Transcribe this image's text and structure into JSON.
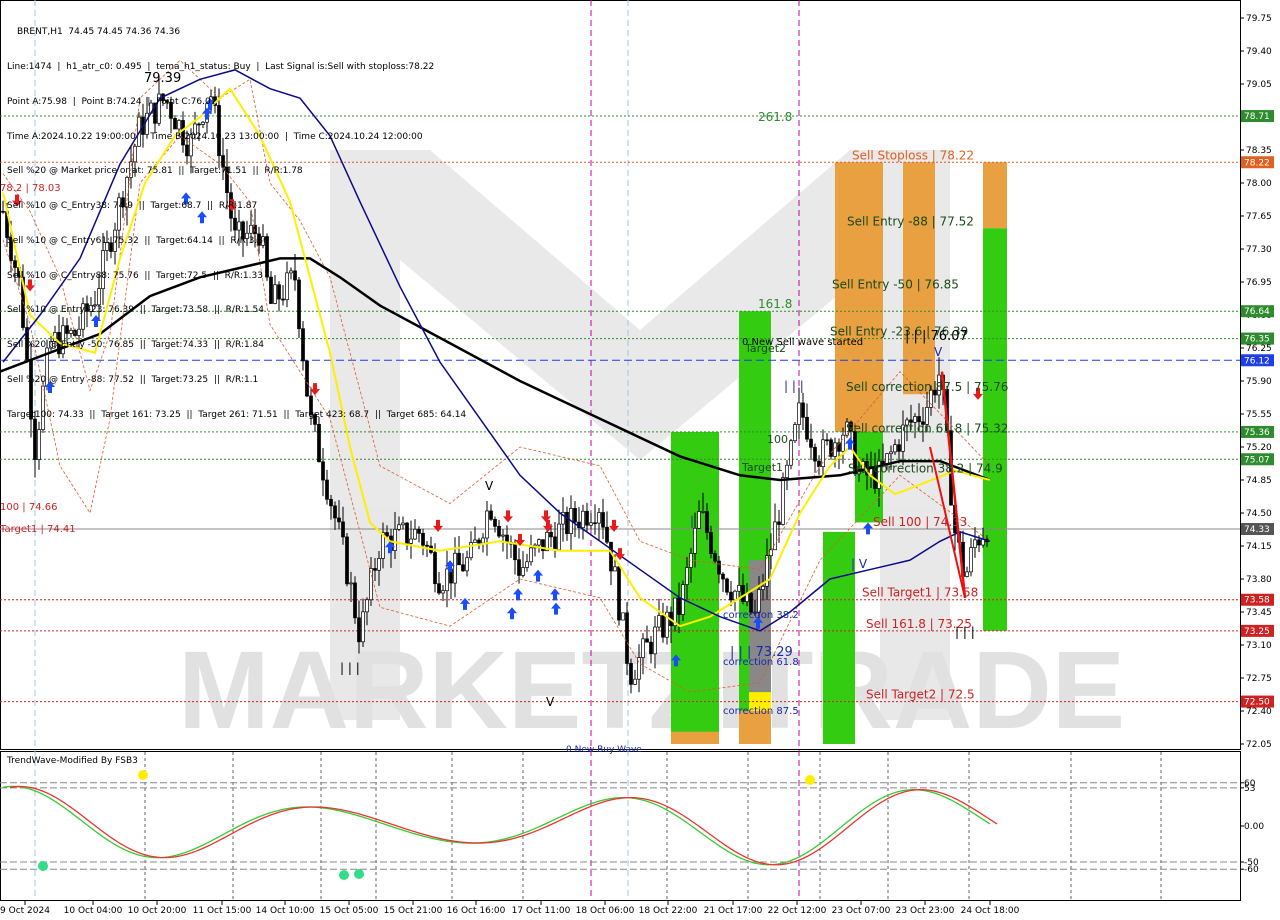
{
  "instrument": {
    "symbol_header": "BRENT,H1  74.45 74.45 74.36 74.36"
  },
  "info_lines": [
    "Line:1474  |  h1_atr_c0: 0.495  |  tema_h1_status: Buy  |  Last Signal is:Sell with stoploss:78.22",
    "Point A:75.98  |  Point B:74.24  |  Point C:76.07",
    "Time A:2024.10.22 19:00:00  |  Time B:2024.10.23 13:00:00  |  Time C:2024.10.24 12:00:00",
    "Sell %20 @ Market price or at: 75.81  ||  Target:71.51  ||  R/R:1.78",
    "Sell %10 @ C_Entry38: 74.9  ||  Target:68.7  ||  R/R:1.87",
    "Sell %10 @ C_Entry61: 75.32  ||  Target:64.14  ||  R/R:3.86",
    "Sell %10 @ C_Entry88: 75.76  ||  Target:72.5  ||  R/R:1.33",
    "Sell %10 @ Entry -23: 76.39  ||  Target:73.58  ||  R/R:1.54",
    "Sell %20 @ Entry -50: 76.85  ||  Target:74.33  ||  R/R:1.84",
    "Sell %20 @ Entry -88: 77.52  ||  Target:73.25  ||  R/R:1.1",
    "Target100: 74.33  ||  Target 161: 73.25  ||  Target 261: 71.51  ||  Target 423: 68.7  ||  Target 685: 64.14"
  ],
  "watermark": "MARKETZITRADE",
  "price_axis": {
    "ticks": [
      "79.75",
      "79.40",
      "79.05",
      "78.70",
      "78.35",
      "78.00",
      "77.65",
      "77.30",
      "76.95",
      "76.60",
      "76.25",
      "75.90",
      "75.55",
      "75.20",
      "74.85",
      "74.50",
      "74.15",
      "73.80",
      "73.45",
      "73.10",
      "72.75",
      "72.40",
      "72.05"
    ],
    "tags": [
      {
        "label": "78.71",
        "value": 78.71,
        "color": "#2e8b2e"
      },
      {
        "label": "78.22",
        "value": 78.22,
        "color": "#e06020"
      },
      {
        "label": "76.64",
        "value": 76.64,
        "color": "#2e8b2e"
      },
      {
        "label": "76.35",
        "value": 76.35,
        "color": "#2e8b2e"
      },
      {
        "label": "76.12",
        "value": 76.12,
        "color": "#1e3ee8"
      },
      {
        "label": "75.36",
        "value": 75.36,
        "color": "#2e8b2e"
      },
      {
        "label": "75.07",
        "value": 75.07,
        "color": "#2e8b2e"
      },
      {
        "label": "74.33",
        "value": 74.33,
        "color": "#555555"
      },
      {
        "label": "73.58",
        "value": 73.58,
        "color": "#cc2222"
      },
      {
        "label": "73.25",
        "value": 73.25,
        "color": "#cc2222"
      },
      {
        "label": "72.50",
        "value": 72.5,
        "color": "#cc2222"
      }
    ]
  },
  "levels": [
    {
      "text": "261.8",
      "value": 78.71,
      "color": "#2e8b2e"
    },
    {
      "text": "Sell Stoploss | 78.22",
      "value": 78.22,
      "color": "#e06020"
    },
    {
      "text": "Sell Entry -88 | 77.52",
      "value": 77.52,
      "color": "#1a4a1a"
    },
    {
      "text": "Sell Entry -50 | 76.85",
      "value": 76.85,
      "color": "#1a4a1a"
    },
    {
      "text": "161.8",
      "value": 76.64,
      "color": "#2e8b2e"
    },
    {
      "text": "Sell Entry -23.6 | 76.39",
      "value": 76.35,
      "color": "#1a4a1a"
    },
    {
      "text": "Sell correction 87.5 | 75.76",
      "value": 75.76,
      "color": "#1a4a1a"
    },
    {
      "text": "Sell correction 61.8 | 75.32",
      "value": 75.32,
      "color": "#1a4a1a"
    },
    {
      "text": "Sell correction 38.2 | 74.9",
      "value": 74.9,
      "color": "#1a4a1a"
    },
    {
      "text": "Sell 100 | 74.33",
      "value": 74.33,
      "color": "#cc2222"
    },
    {
      "text": "Sell Target1 | 73.58",
      "value": 73.58,
      "color": "#cc2222"
    },
    {
      "text": "Sell 161.8 | 73.25",
      "value": 73.25,
      "color": "#cc2222"
    },
    {
      "text": "Sell Target2 | 72.5",
      "value": 72.5,
      "color": "#cc2222"
    }
  ],
  "annotations": {
    "left_high": "79.39",
    "left_level": "78.2 | 78.03",
    "left_100": "100 | 74.66",
    "left_target": "Target1 | 74.41",
    "mid_low": "| | | 73.29",
    "right_high": "| | | 76.07",
    "new_wave": "0 New Sell wave started",
    "target2": "Target2",
    "hundred": "100",
    "target1": "Target1",
    "corr38": "correction 38.2",
    "corr61": "correction 61.8",
    "corr87": "correction 87.5",
    "bars_mid": "| | |",
    "bars_low": "| | |",
    "v1": "V",
    "v2": "V",
    "v3": "V",
    "v4": "| V",
    "bottom_cut": "0 New Buy Wave"
  },
  "oscillator": {
    "title": "TrendWave-Modified By FSB3",
    "ticks": [
      "60",
      "53",
      "0.00",
      "-50",
      "-60"
    ]
  },
  "time_axis": {
    "labels": [
      "9 Oct 2024",
      "10 Oct 04:00",
      "10 Oct 20:00",
      "11 Oct 15:00",
      "14 Oct 10:00",
      "15 Oct 05:00",
      "15 Oct 21:00",
      "16 Oct 16:00",
      "17 Oct 11:00",
      "18 Oct 06:00",
      "18 Oct 22:00",
      "21 Oct 17:00",
      "22 Oct 12:00",
      "23 Oct 07:00",
      "23 Oct 23:00",
      "24 Oct 18:00"
    ]
  },
  "colors": {
    "bull_zone": "#33cc11",
    "sell_zone": "#e8a040",
    "ma_yellow": "#ffee00",
    "ma_black": "#000000",
    "ma_navy": "#0a0a8a",
    "osc_green": "#33cc33",
    "osc_red": "#ee3333"
  }
}
